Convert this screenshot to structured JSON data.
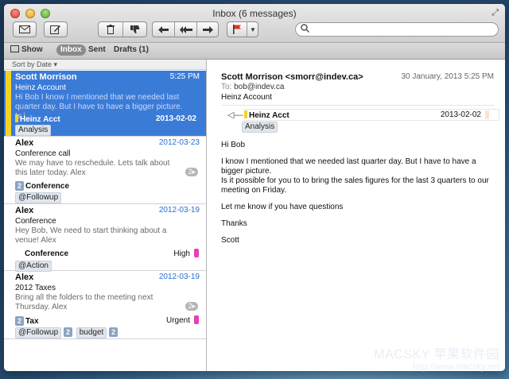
{
  "window": {
    "title": "Inbox (6 messages)"
  },
  "toolbar": {
    "icons": [
      "envelope-icon",
      "compose-icon",
      "trash-icon",
      "thumbs-down-icon",
      "reply-icon",
      "reply-all-icon",
      "forward-icon",
      "flag-icon",
      "chevron-down-icon",
      "search-icon"
    ],
    "search_placeholder": ""
  },
  "filterbar": {
    "show": "Show",
    "inbox": "Inbox",
    "sent": "Sent",
    "drafts": "Drafts (1)"
  },
  "list": {
    "sort_label": "Sort by Date ▾",
    "messages": [
      {
        "from": "Scott Morrison",
        "date": "5:25 PM",
        "subject": "Heinz Account",
        "preview": "Hi Bob I know I mentioned that we needed last quarter day. But I have to have a bigger picture. Is i...",
        "tag": "Heinz Acct",
        "tag_date": "2013-02-02",
        "label": "Analysis"
      },
      {
        "from": "Alex",
        "date": "2012-03-23",
        "subject": "Conference call",
        "preview": "We may have to reschedule. Lets talk about this later today. Alex",
        "count": "2▸",
        "tag_badge": "2",
        "tag": "Conference",
        "label": "@Followup"
      },
      {
        "from": "Alex",
        "date": "2012-03-19",
        "subject": "Conference",
        "preview": "Hey Bob, We need to start thinking about a venue! Alex",
        "tag": "Conference",
        "priority": "High",
        "label": "@Action"
      },
      {
        "from": "Alex",
        "date": "2012-03-19",
        "subject": "2012 Taxes",
        "preview": "Bring all the folders to the meeting next Thursday. Alex",
        "count": "2▸",
        "tag_badge": "2",
        "tag": "Tax",
        "priority": "Urgent",
        "label": "@Followup",
        "label_badge": "2",
        "label2": "budget",
        "label2_badge": "2"
      }
    ]
  },
  "detail": {
    "from": "Scott Morrison <smorr@indev.ca>",
    "date": "30 January, 2013 5:25 PM",
    "to_label": "To:",
    "to": "bob@indev.ca",
    "subject": "Heinz Account",
    "tag": "Heinz Acct",
    "tag_date": "2013-02-02",
    "label": "Analysis",
    "body": [
      "Hi Bob",
      "I know I mentioned that we needed last quarter day.   But I have to have a bigger picture.",
      "Is it possible for you to to bring the sales figures for the last 3 quarters to our meeting on Friday.",
      "Let me know if you have questions",
      "Thanks",
      "Scott"
    ]
  },
  "watermark": {
    "line1": "MACSKY 苹果软件园",
    "line2": "http://www.macsky.net"
  },
  "colors": {
    "selection": "#3b7bd8",
    "tag_yellow": "#f4d324",
    "priority_pink": "#e83fb6",
    "date_blue": "#2a6fd3"
  }
}
